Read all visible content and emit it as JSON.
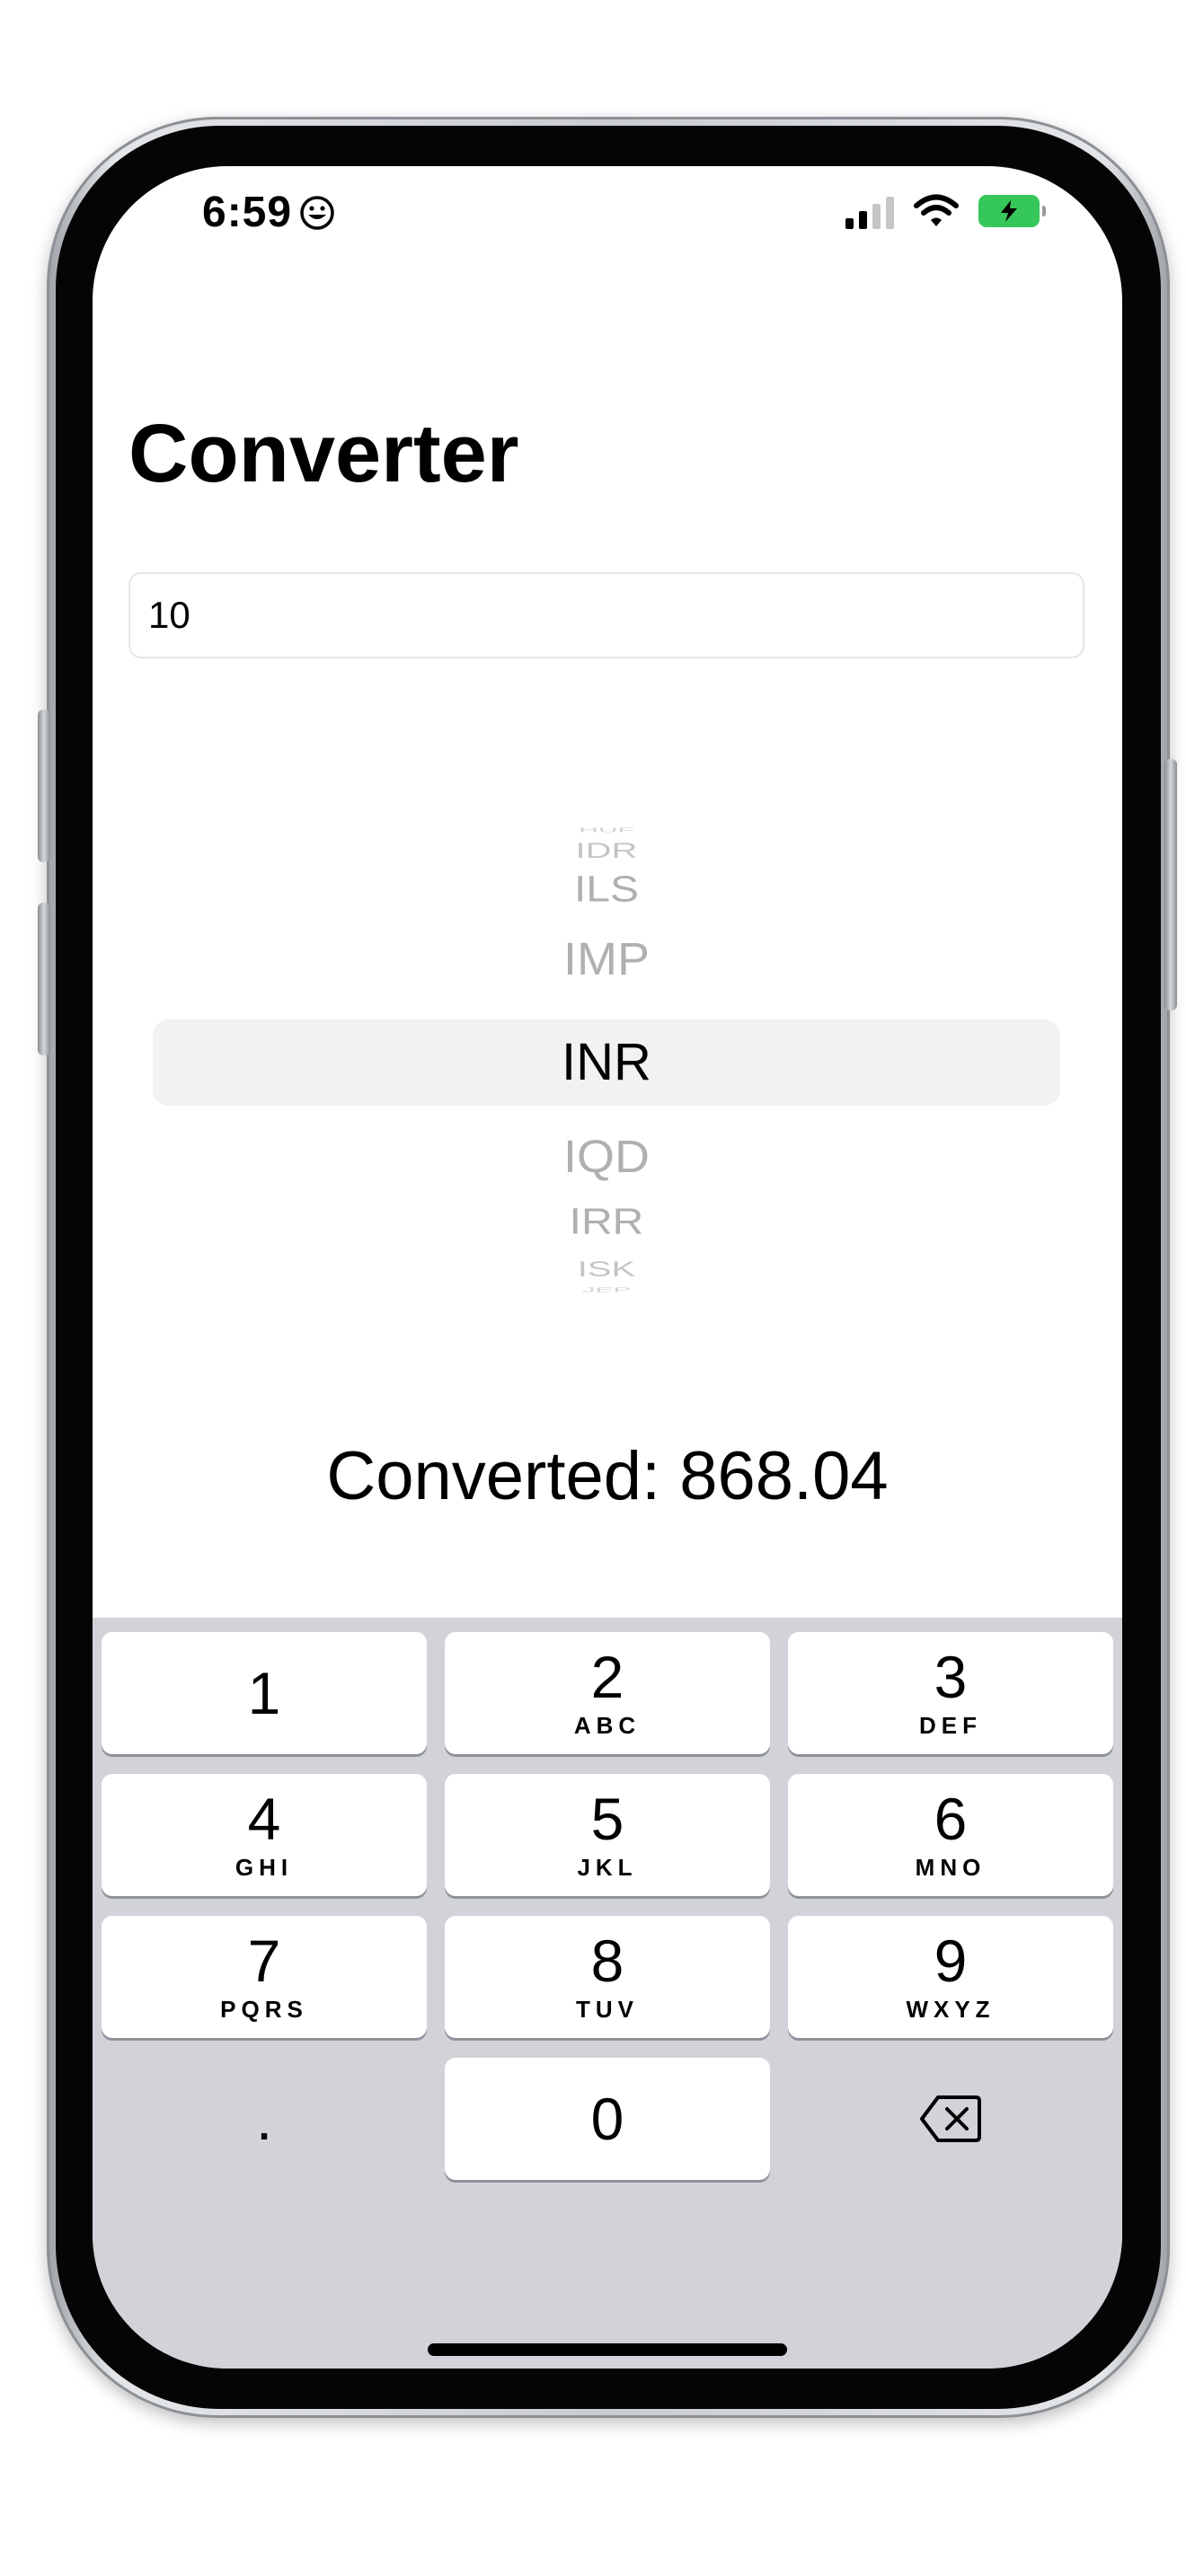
{
  "status_bar": {
    "time": "6:59",
    "time_icon": "smile-emoji-icon"
  },
  "header": {
    "title": "Converter"
  },
  "amount_input": {
    "value": "10"
  },
  "currency_picker": {
    "items": [
      "HUF",
      "IDR",
      "ILS",
      "IMP",
      "INR",
      "IQD",
      "IRR",
      "ISK",
      "JEP"
    ],
    "selected": "INR"
  },
  "result": {
    "text": "Converted: 868.04"
  },
  "keypad": {
    "keys": [
      {
        "digit": "1",
        "letters": ""
      },
      {
        "digit": "2",
        "letters": "ABC"
      },
      {
        "digit": "3",
        "letters": "DEF"
      },
      {
        "digit": "4",
        "letters": "GHI"
      },
      {
        "digit": "5",
        "letters": "JKL"
      },
      {
        "digit": "6",
        "letters": "MNO"
      },
      {
        "digit": "7",
        "letters": "PQRS"
      },
      {
        "digit": "8",
        "letters": "TUV"
      },
      {
        "digit": "9",
        "letters": "WXYZ"
      },
      {
        "digit": ".",
        "letters": ""
      },
      {
        "digit": "0",
        "letters": ""
      }
    ],
    "delete_icon": "backspace-icon"
  },
  "colors": {
    "battery_fill": "#35c759",
    "keyboard_bg": "#d1d3d9",
    "picker_highlight": "#f2f2f3"
  }
}
